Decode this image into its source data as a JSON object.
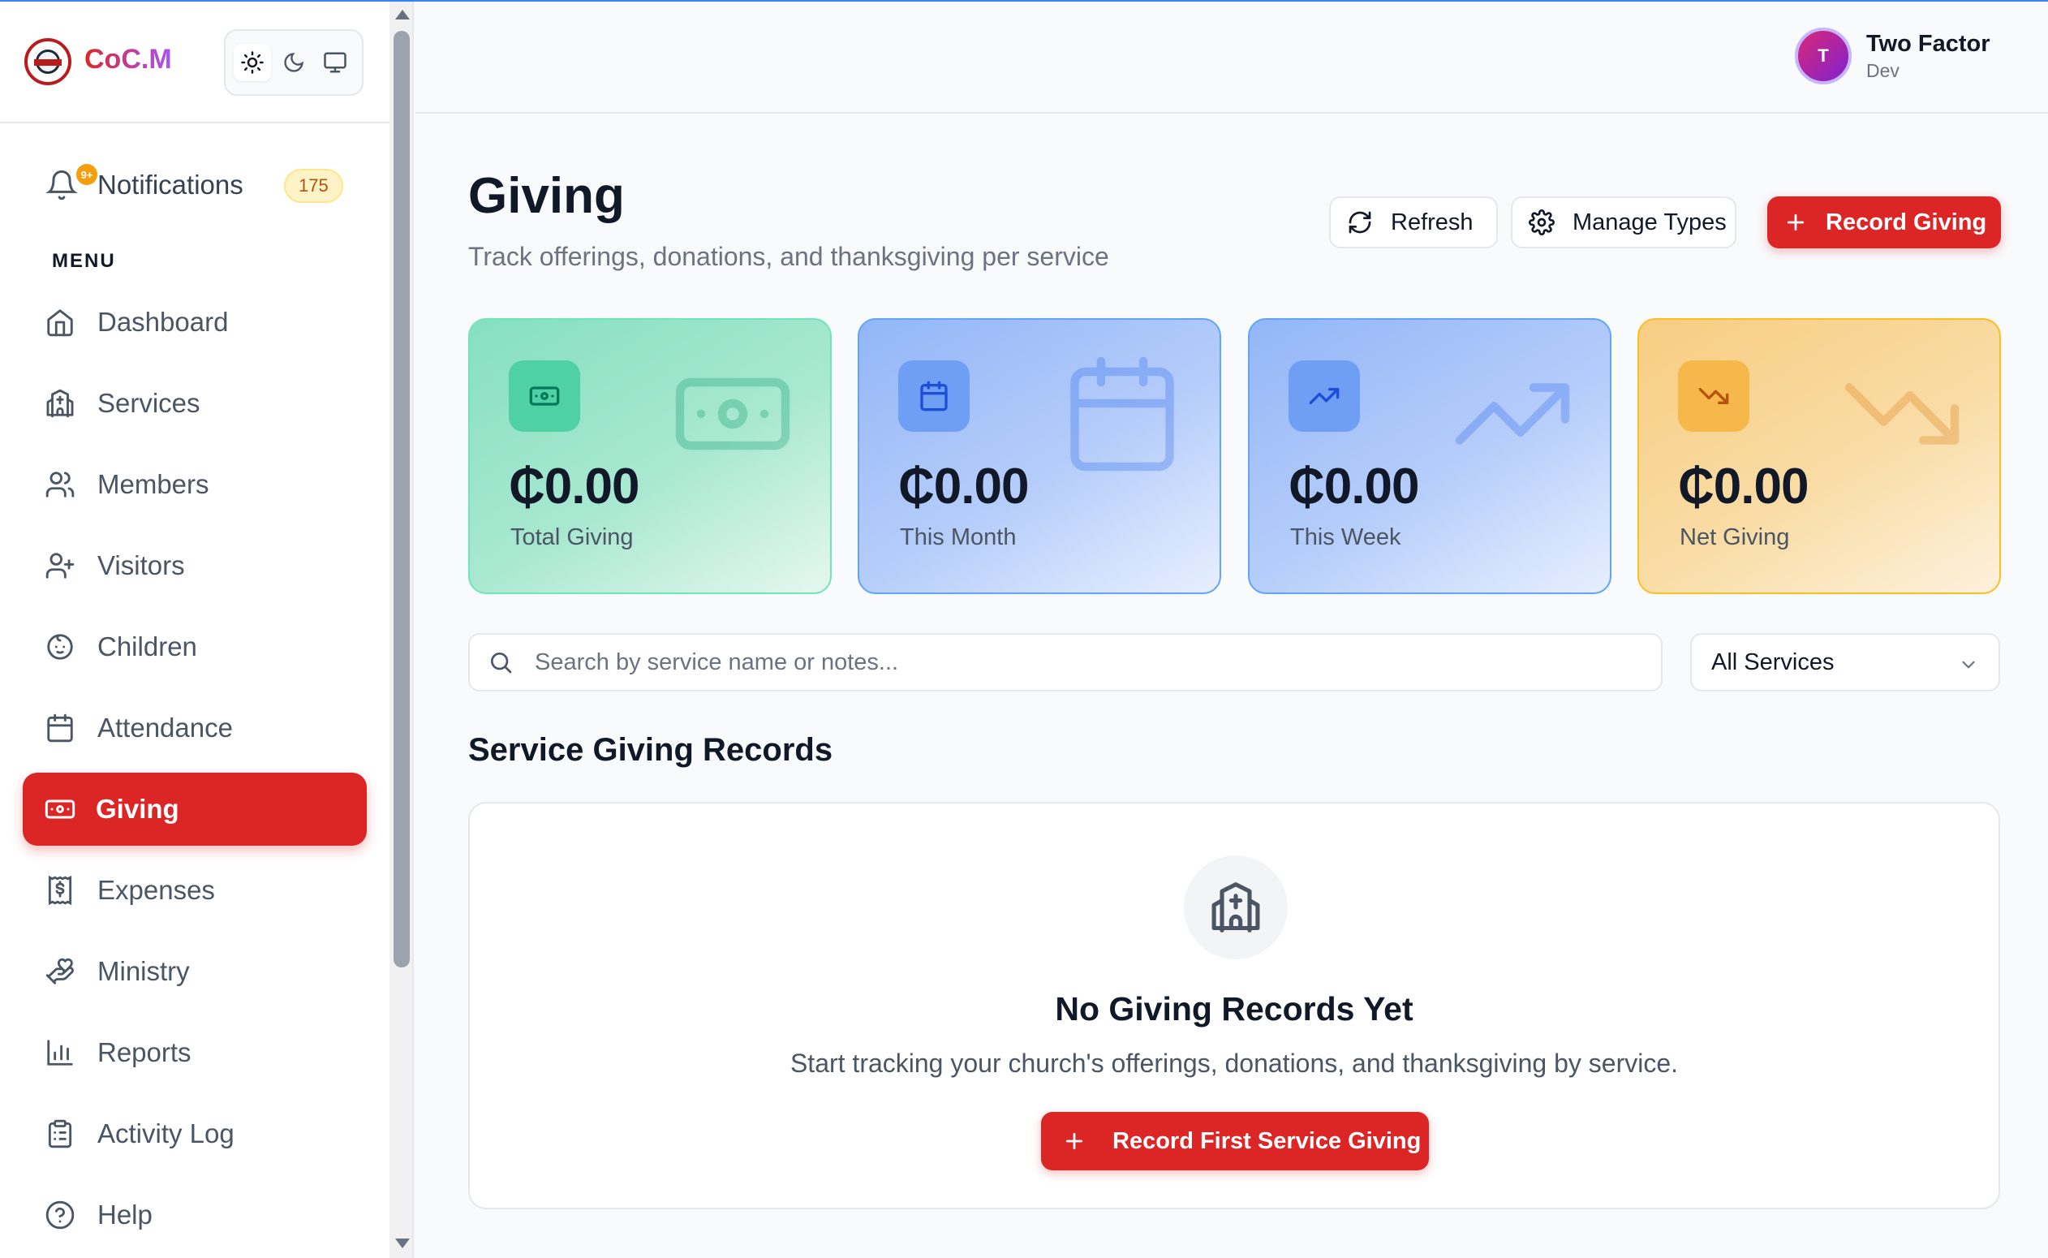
{
  "app": {
    "name": "CoC.M"
  },
  "colors": {
    "primary": "#dc2626",
    "accent_gradient": [
      "#dc2626",
      "#a855f7"
    ]
  },
  "theme_toggle": {
    "options": [
      "light-icon",
      "dark-icon",
      "system-icon"
    ],
    "selected": "light"
  },
  "notifications": {
    "label": "Notifications",
    "badge": "9+",
    "count": "175"
  },
  "sidebar": {
    "menu_title": "MENU",
    "items": [
      {
        "label": "Dashboard",
        "icon": "home-icon"
      },
      {
        "label": "Services",
        "icon": "church-icon"
      },
      {
        "label": "Members",
        "icon": "users-icon"
      },
      {
        "label": "Visitors",
        "icon": "user-plus-icon"
      },
      {
        "label": "Children",
        "icon": "baby-icon"
      },
      {
        "label": "Attendance",
        "icon": "calendar-icon"
      },
      {
        "label": "Giving",
        "icon": "banknote-icon",
        "active": true
      },
      {
        "label": "Expenses",
        "icon": "receipt-icon"
      },
      {
        "label": "Ministry",
        "icon": "hand-heart-icon"
      },
      {
        "label": "Reports",
        "icon": "bar-chart-icon"
      },
      {
        "label": "Activity Log",
        "icon": "clipboard-icon"
      },
      {
        "label": "Help",
        "icon": "help-circle-icon"
      }
    ]
  },
  "user": {
    "initial": "T",
    "name": "Two Factor",
    "role": "Dev"
  },
  "page": {
    "title": "Giving",
    "subtitle": "Track offerings, donations, and thanksgiving per service",
    "actions": {
      "refresh": "Refresh",
      "manage_types": "Manage Types",
      "record_giving": "Record Giving"
    }
  },
  "stats": [
    {
      "value": "₵0.00",
      "label": "Total Giving",
      "icon": "banknote-icon",
      "color": "#059669"
    },
    {
      "value": "₵0.00",
      "label": "This Month",
      "icon": "calendar-icon",
      "color": "#2563eb"
    },
    {
      "value": "₵0.00",
      "label": "This Week",
      "icon": "trending-up-icon",
      "color": "#2563eb"
    },
    {
      "value": "₵0.00",
      "label": "Net Giving",
      "icon": "trending-down-icon",
      "color": "#d97706"
    }
  ],
  "filters": {
    "search_placeholder": "Search by service name or notes...",
    "search_value": "",
    "service_select": "All Services"
  },
  "records": {
    "section_title": "Service Giving Records",
    "empty_title": "No Giving Records Yet",
    "empty_description": "Start tracking your church's offerings, donations, and thanksgiving by service.",
    "empty_button": "Record First Service Giving"
  }
}
